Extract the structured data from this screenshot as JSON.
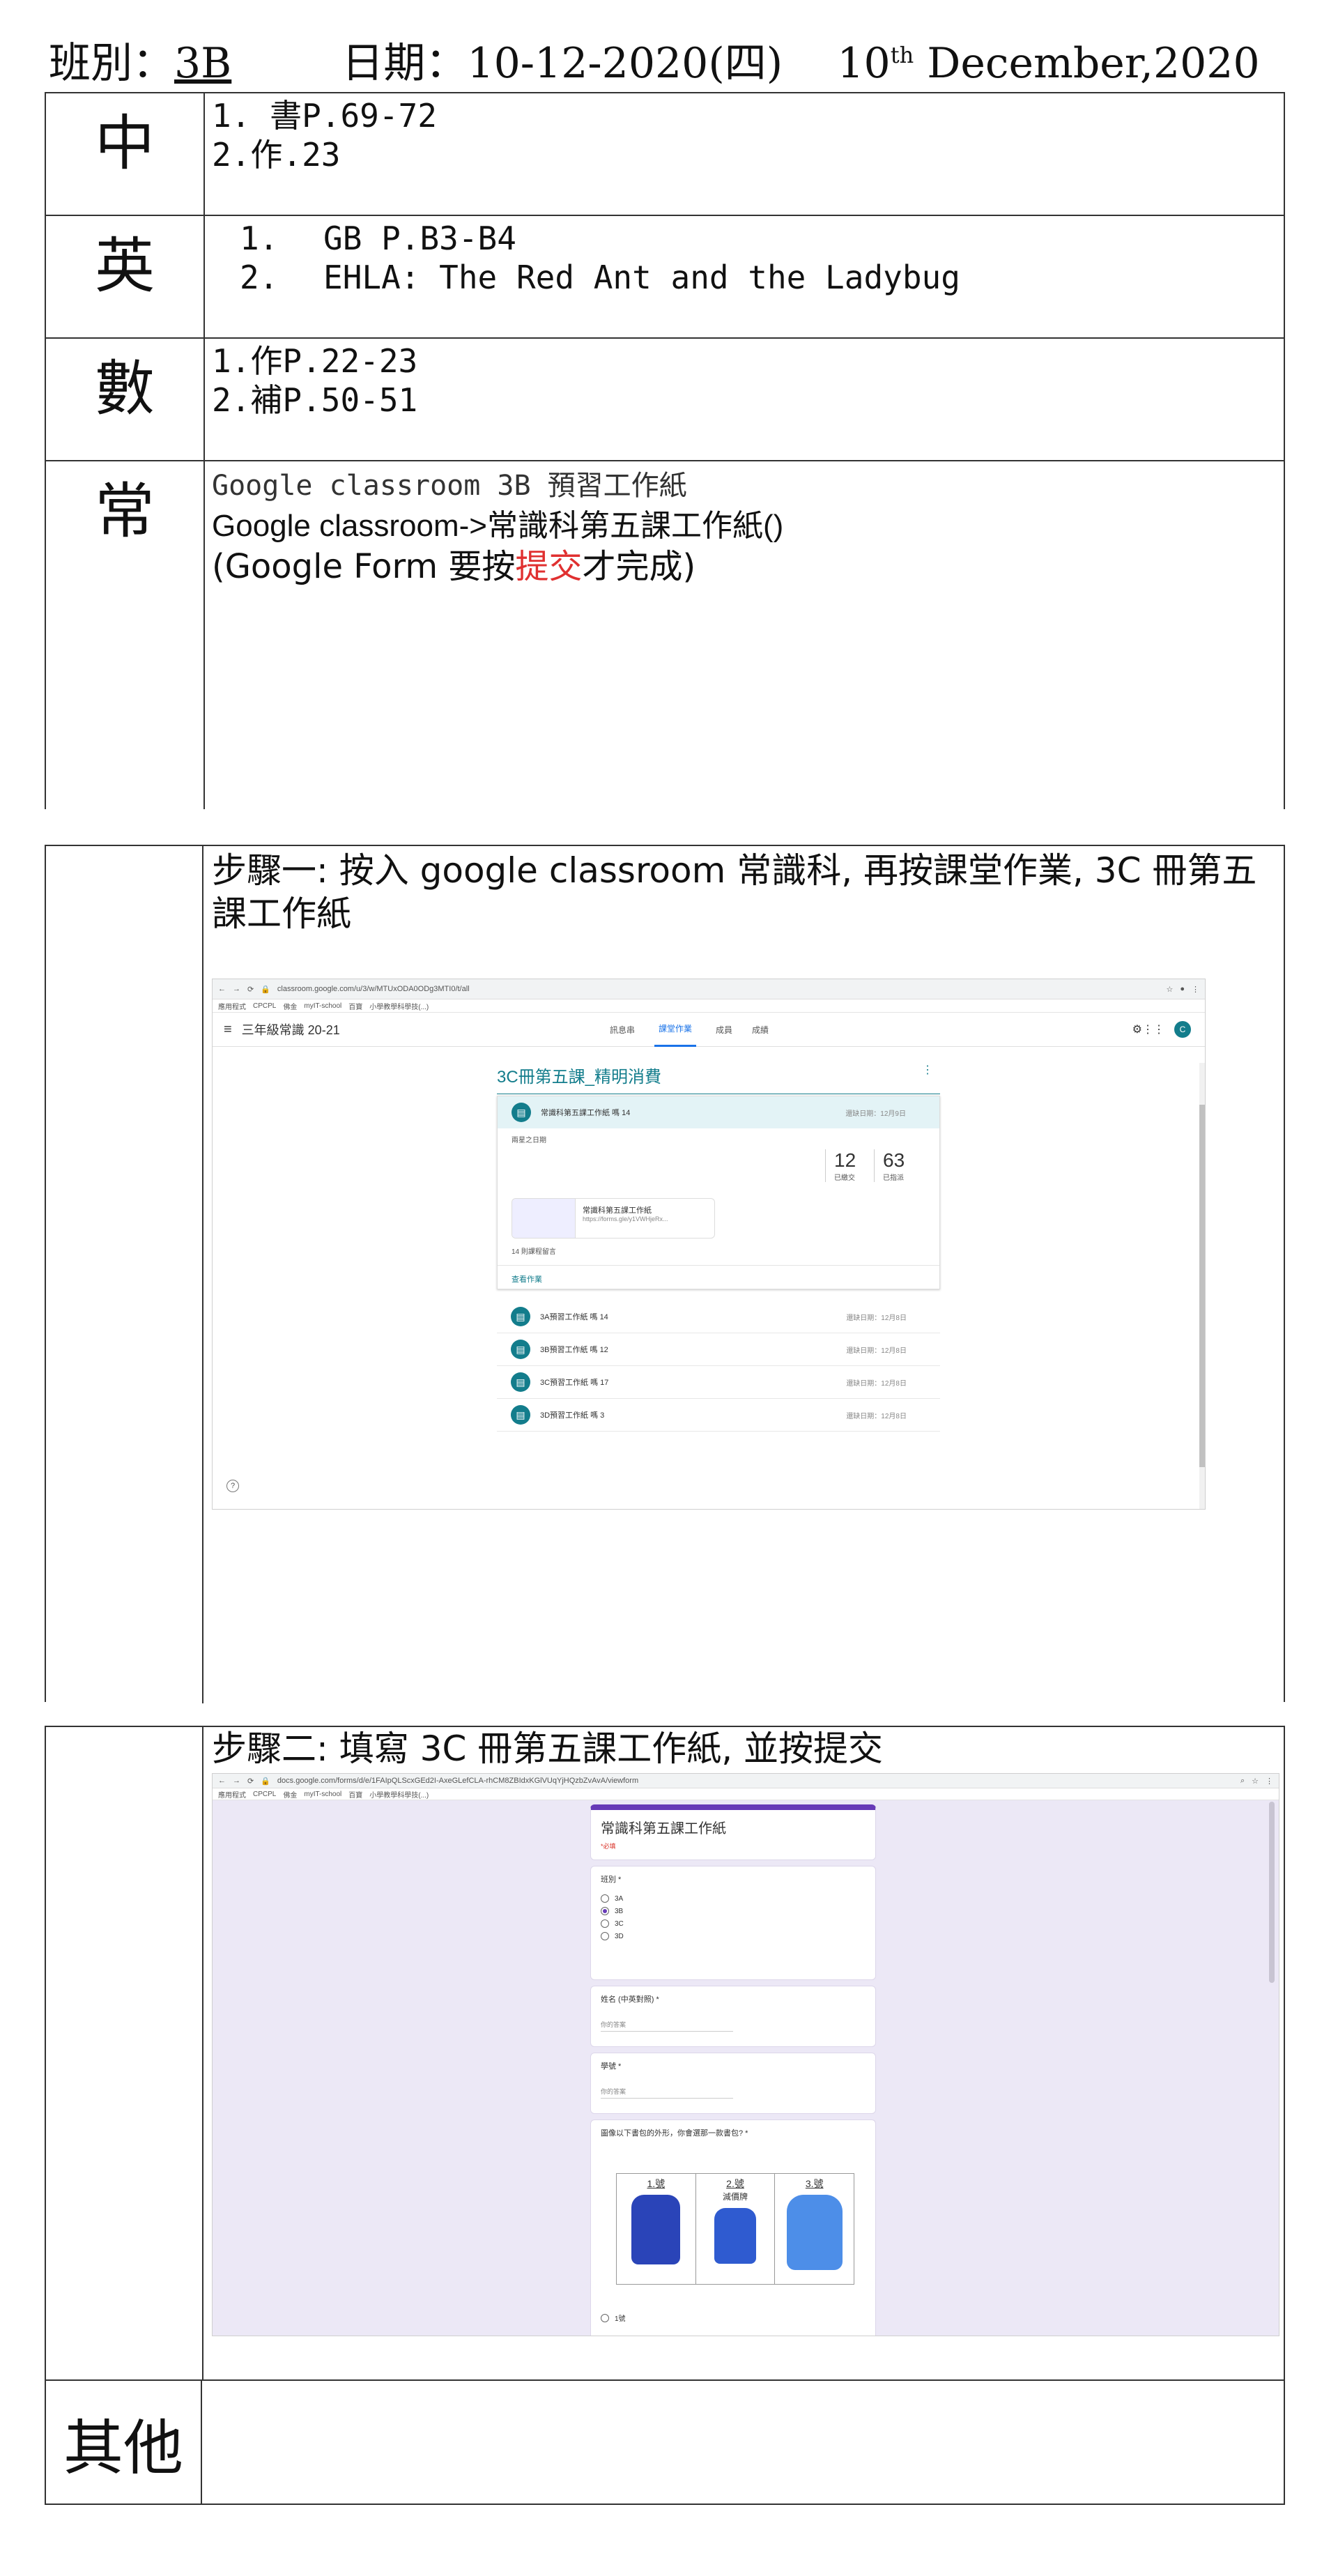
{
  "header": {
    "class_label": "班別：",
    "class_value": "3B",
    "date_label": "日期：",
    "date_value": "10-12-2020(四)",
    "date_en_day": "10",
    "date_en_sup": "th",
    "date_en_rest": "December,2020"
  },
  "subjects": {
    "chinese": {
      "name": "中",
      "lines": [
        "1. 書P.69-72",
        "2.作.23"
      ]
    },
    "english": {
      "name": "英",
      "lines": [
        {
          "num": "1.",
          "text": "GB P.B3-B4"
        },
        {
          "num": "2.",
          "text": "EHLA: The Red Ant and the Ladybug"
        }
      ]
    },
    "math": {
      "name": "數",
      "lines": [
        "1.作P.22-23",
        "2.補P.50-51"
      ]
    },
    "general": {
      "name": "常",
      "line1": "Google classroom 3B 預習工作紙",
      "line2": "Google classroom->常識科第五課工作紙()",
      "line3_pre": "(Google Form 要按",
      "line3_red": "提交",
      "line3_post": "才完成)"
    },
    "other": {
      "name": "其他"
    }
  },
  "steps": {
    "step1": "步驟一: 按入 google classroom 常識科, 再按課堂作業, 3C 冊第五課工作紙",
    "step2": "步驟二: 填寫 3C 冊第五課工作紙, 並按提交"
  },
  "screenshot1": {
    "url": "classroom.google.com/u/3/w/MTUxODA0ODg3MTI0/t/all",
    "bookmarks": [
      "應用程式",
      "CPCPL",
      "佛金",
      "myIT-school",
      "百寶",
      "小學教學科學技(...)"
    ],
    "class_title": "三年級常識 20-21",
    "tabs": [
      "訊息串",
      "課堂作業",
      "成員",
      "成績"
    ],
    "active_tab": "課堂作業",
    "topic_title": "3C冊第五課_精明消費",
    "main_assignment": "常識科第五課工作紙 嗎 14",
    "main_due": "還缺日期：12月9日",
    "posted": "兩星之日期",
    "handed_in": "12",
    "handed_in_label": "已繳交",
    "assigned": "63",
    "assigned_label": "已指派",
    "attachment_title": "常識科第五課工作紙",
    "attachment_url": "https://forms.gle/y1VWHjeRx...",
    "class_comments": "14 則課程留言",
    "view_link": "查看作業",
    "other_assignments": [
      {
        "title": "3A預習工作紙 嗎 14",
        "due": "還缺日期：12月8日"
      },
      {
        "title": "3B預習工作紙 嗎 12",
        "due": "還缺日期：12月8日"
      },
      {
        "title": "3C預習工作紙 嗎 17",
        "due": "還缺日期：12月8日"
      },
      {
        "title": "3D預習工作紙 嗎 3",
        "due": "還缺日期：12月8日"
      }
    ]
  },
  "screenshot2": {
    "url": "docs.google.com/forms/d/e/1FAIpQLScxGEd2I-AxeGLefCLA-rhCM8ZBIdxKGlVUqYjHQzbZvAvA/viewform",
    "form_title": "常識科第五課工作紙",
    "required_note": "*必填",
    "q1_label": "班別 *",
    "q1_options": [
      "3A",
      "3B",
      "3C",
      "3D"
    ],
    "q1_selected": "3B",
    "q2_label": "姓名 (中英對照) *",
    "q2_placeholder": "你的答案",
    "q3_label": "學號 *",
    "q3_placeholder": "你的答案",
    "q4_label": "圖像以下書包的外形，你會選那一款書包? *",
    "bag_labels": [
      "1.號",
      "2.號",
      "3.號"
    ],
    "bag2_note": "減價牌",
    "q4_first_option": "1號"
  },
  "colors": {
    "teal": "#137d8c",
    "form_bg": "#ece8f6",
    "form_purple": "#673ab7",
    "red": "#e03030",
    "link_blue": "#1a73e8"
  }
}
